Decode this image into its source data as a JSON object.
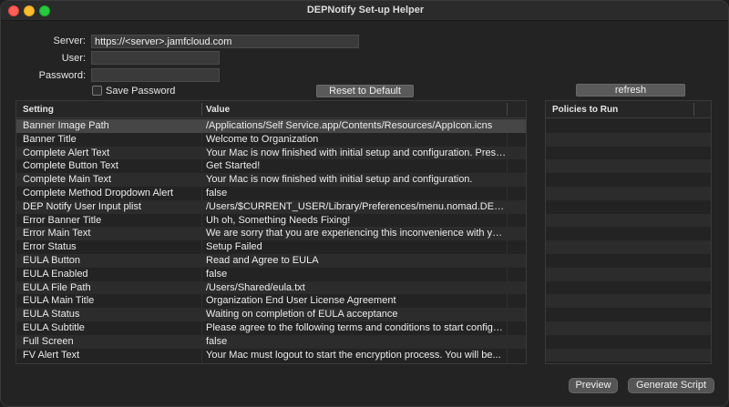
{
  "window": {
    "title": "DEPNotify Set-up Helper"
  },
  "form": {
    "server_label": "Server:",
    "server_value": "https://<server>.jamfcloud.com",
    "user_label": "User:",
    "user_value": "",
    "password_label": "Password:",
    "password_value": "",
    "save_password_label": "Save Password",
    "save_password_checked": false
  },
  "buttons": {
    "reset": "Reset to Default",
    "refresh": "refresh",
    "preview": "Preview",
    "generate": "Generate Script"
  },
  "settings_table": {
    "columns": [
      "Setting",
      "Value"
    ],
    "rows": [
      {
        "setting": "Banner Image Path",
        "value": "/Applications/Self Service.app/Contents/Resources/AppIcon.icns"
      },
      {
        "setting": "Banner Title",
        "value": "Welcome to Organization"
      },
      {
        "setting": "Complete Alert Text",
        "value": "Your Mac is now finished with initial setup and configuration. Press..."
      },
      {
        "setting": "Complete Button Text",
        "value": "Get Started!"
      },
      {
        "setting": "Complete Main Text",
        "value": "Your Mac is now finished with initial setup and configuration."
      },
      {
        "setting": "Complete Method Dropdown Alert",
        "value": "false"
      },
      {
        "setting": "DEP Notify User Input plist",
        "value": "/Users/$CURRENT_USER/Library/Preferences/menu.nomad.DEPNo..."
      },
      {
        "setting": "Error Banner Title",
        "value": "Uh oh, Something Needs Fixing!"
      },
      {
        "setting": "Error Main Text",
        "value": "We are sorry that you are experiencing this inconvenience with you..."
      },
      {
        "setting": "Error Status",
        "value": "Setup Failed"
      },
      {
        "setting": "EULA Button",
        "value": "Read and Agree to EULA"
      },
      {
        "setting": "EULA Enabled",
        "value": "false"
      },
      {
        "setting": "EULA File Path",
        "value": "/Users/Shared/eula.txt"
      },
      {
        "setting": "EULA Main Title",
        "value": "Organization End User License Agreement"
      },
      {
        "setting": "EULA Status",
        "value": "Waiting on completion of EULA acceptance"
      },
      {
        "setting": "EULA Subtitle",
        "value": "Please agree to the following terms and conditions to start configu..."
      },
      {
        "setting": "Full Screen",
        "value": "false"
      },
      {
        "setting": "FV Alert Text",
        "value": "Your Mac must logout to start the encryption process. You will be..."
      }
    ]
  },
  "policies_table": {
    "columns": [
      "Policies to Run"
    ],
    "rows": []
  }
}
